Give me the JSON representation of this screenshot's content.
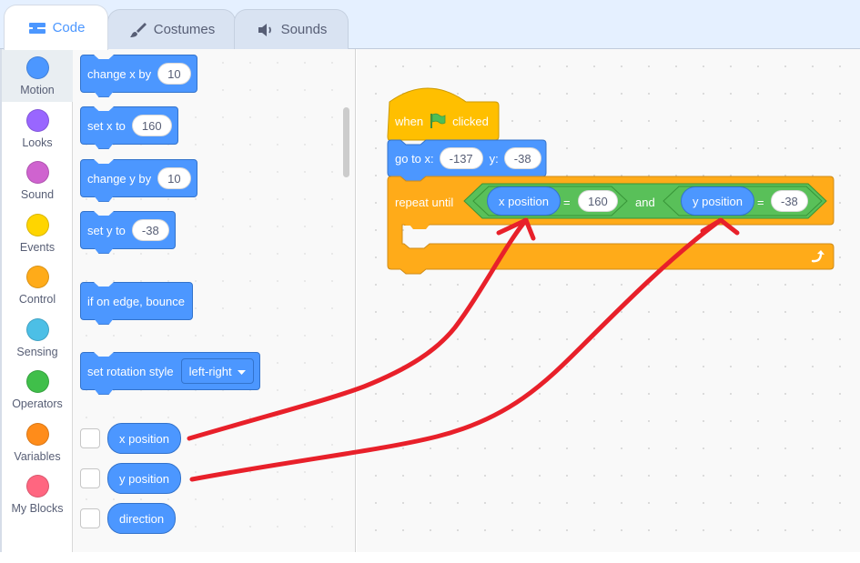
{
  "tabs": [
    {
      "label": "Code",
      "icon": "code-blocks-icon",
      "active": true
    },
    {
      "label": "Costumes",
      "icon": "paintbrush-icon",
      "active": false
    },
    {
      "label": "Sounds",
      "icon": "speaker-icon",
      "active": false
    }
  ],
  "categories": [
    {
      "label": "Motion",
      "color": "#4c97ff",
      "active": true
    },
    {
      "label": "Looks",
      "color": "#9966ff",
      "active": false
    },
    {
      "label": "Sound",
      "color": "#cf63cf",
      "active": false
    },
    {
      "label": "Events",
      "color": "#ffd500",
      "active": false
    },
    {
      "label": "Control",
      "color": "#ffab19",
      "active": false
    },
    {
      "label": "Sensing",
      "color": "#4cbfe6",
      "active": false
    },
    {
      "label": "Operators",
      "color": "#40bf4a",
      "active": false
    },
    {
      "label": "Variables",
      "color": "#ff8c1a",
      "active": false
    },
    {
      "label": "My Blocks",
      "color": "#ff6680",
      "active": false
    }
  ],
  "palette": {
    "change_x": {
      "label": "change x by",
      "value": "10"
    },
    "set_x": {
      "label": "set x to",
      "value": "160"
    },
    "change_y": {
      "label": "change y by",
      "value": "10"
    },
    "set_y": {
      "label": "set y to",
      "value": "-38"
    },
    "bounce": {
      "label": "if on edge, bounce"
    },
    "rotation": {
      "label": "set rotation style",
      "value": "left-right"
    },
    "reporters": [
      {
        "label": "x position",
        "checked": false
      },
      {
        "label": "y position",
        "checked": false
      },
      {
        "label": "direction",
        "checked": false
      }
    ]
  },
  "script": {
    "hat": {
      "when": "when",
      "clicked": "clicked",
      "icon": "green-flag-icon"
    },
    "goto": {
      "label": "go to x:",
      "x": "-137",
      "ylabel": "y:",
      "y": "-38"
    },
    "repeat": {
      "label": "repeat until",
      "left": {
        "reporter": "x position",
        "op": "=",
        "value": "160"
      },
      "and": "and",
      "right": {
        "reporter": "y position",
        "op": "=",
        "value": "-38"
      }
    }
  },
  "colors": {
    "motion": "#4c97ff",
    "events": "#ffbf00",
    "control": "#ffab19",
    "operators": "#59c059",
    "annotation": "#e8202a"
  }
}
